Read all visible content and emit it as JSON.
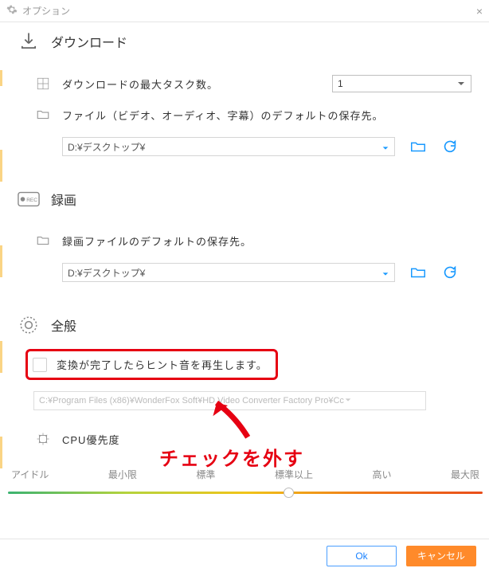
{
  "window": {
    "title": "オプション"
  },
  "download": {
    "title": "ダウンロード",
    "max_tasks_label": "ダウンロードの最大タスク数。",
    "max_tasks_value": "1",
    "output_label": "ファイル（ビデオ、オーディオ、字幕）のデフォルトの保存先。",
    "output_path": "D:¥デスクトップ¥"
  },
  "record": {
    "title": "録画",
    "output_label": "録画ファイルのデフォルトの保存先。",
    "output_path": "D:¥デスクトップ¥"
  },
  "general": {
    "title": "全般",
    "hint_sound_label": "変換が完了したらヒント音を再生します。",
    "hint_sound_path": "C:¥Program Files (x86)¥WonderFox Soft¥HD Video Converter Factory Pro¥Cc",
    "cpu_label": "CPU優先度"
  },
  "priority": {
    "levels": {
      "l0": "アイドル",
      "l1": "最小限",
      "l2": "標準",
      "l3": "標準以上",
      "l4": "高い",
      "l5": "最大限"
    }
  },
  "annotation": {
    "text": "チェックを外す"
  },
  "footer": {
    "ok": "Ok",
    "cancel": "キャンセル"
  },
  "colors": {
    "accent": "#1899ff",
    "orange": "#ff8a2a",
    "red": "#e60012"
  }
}
